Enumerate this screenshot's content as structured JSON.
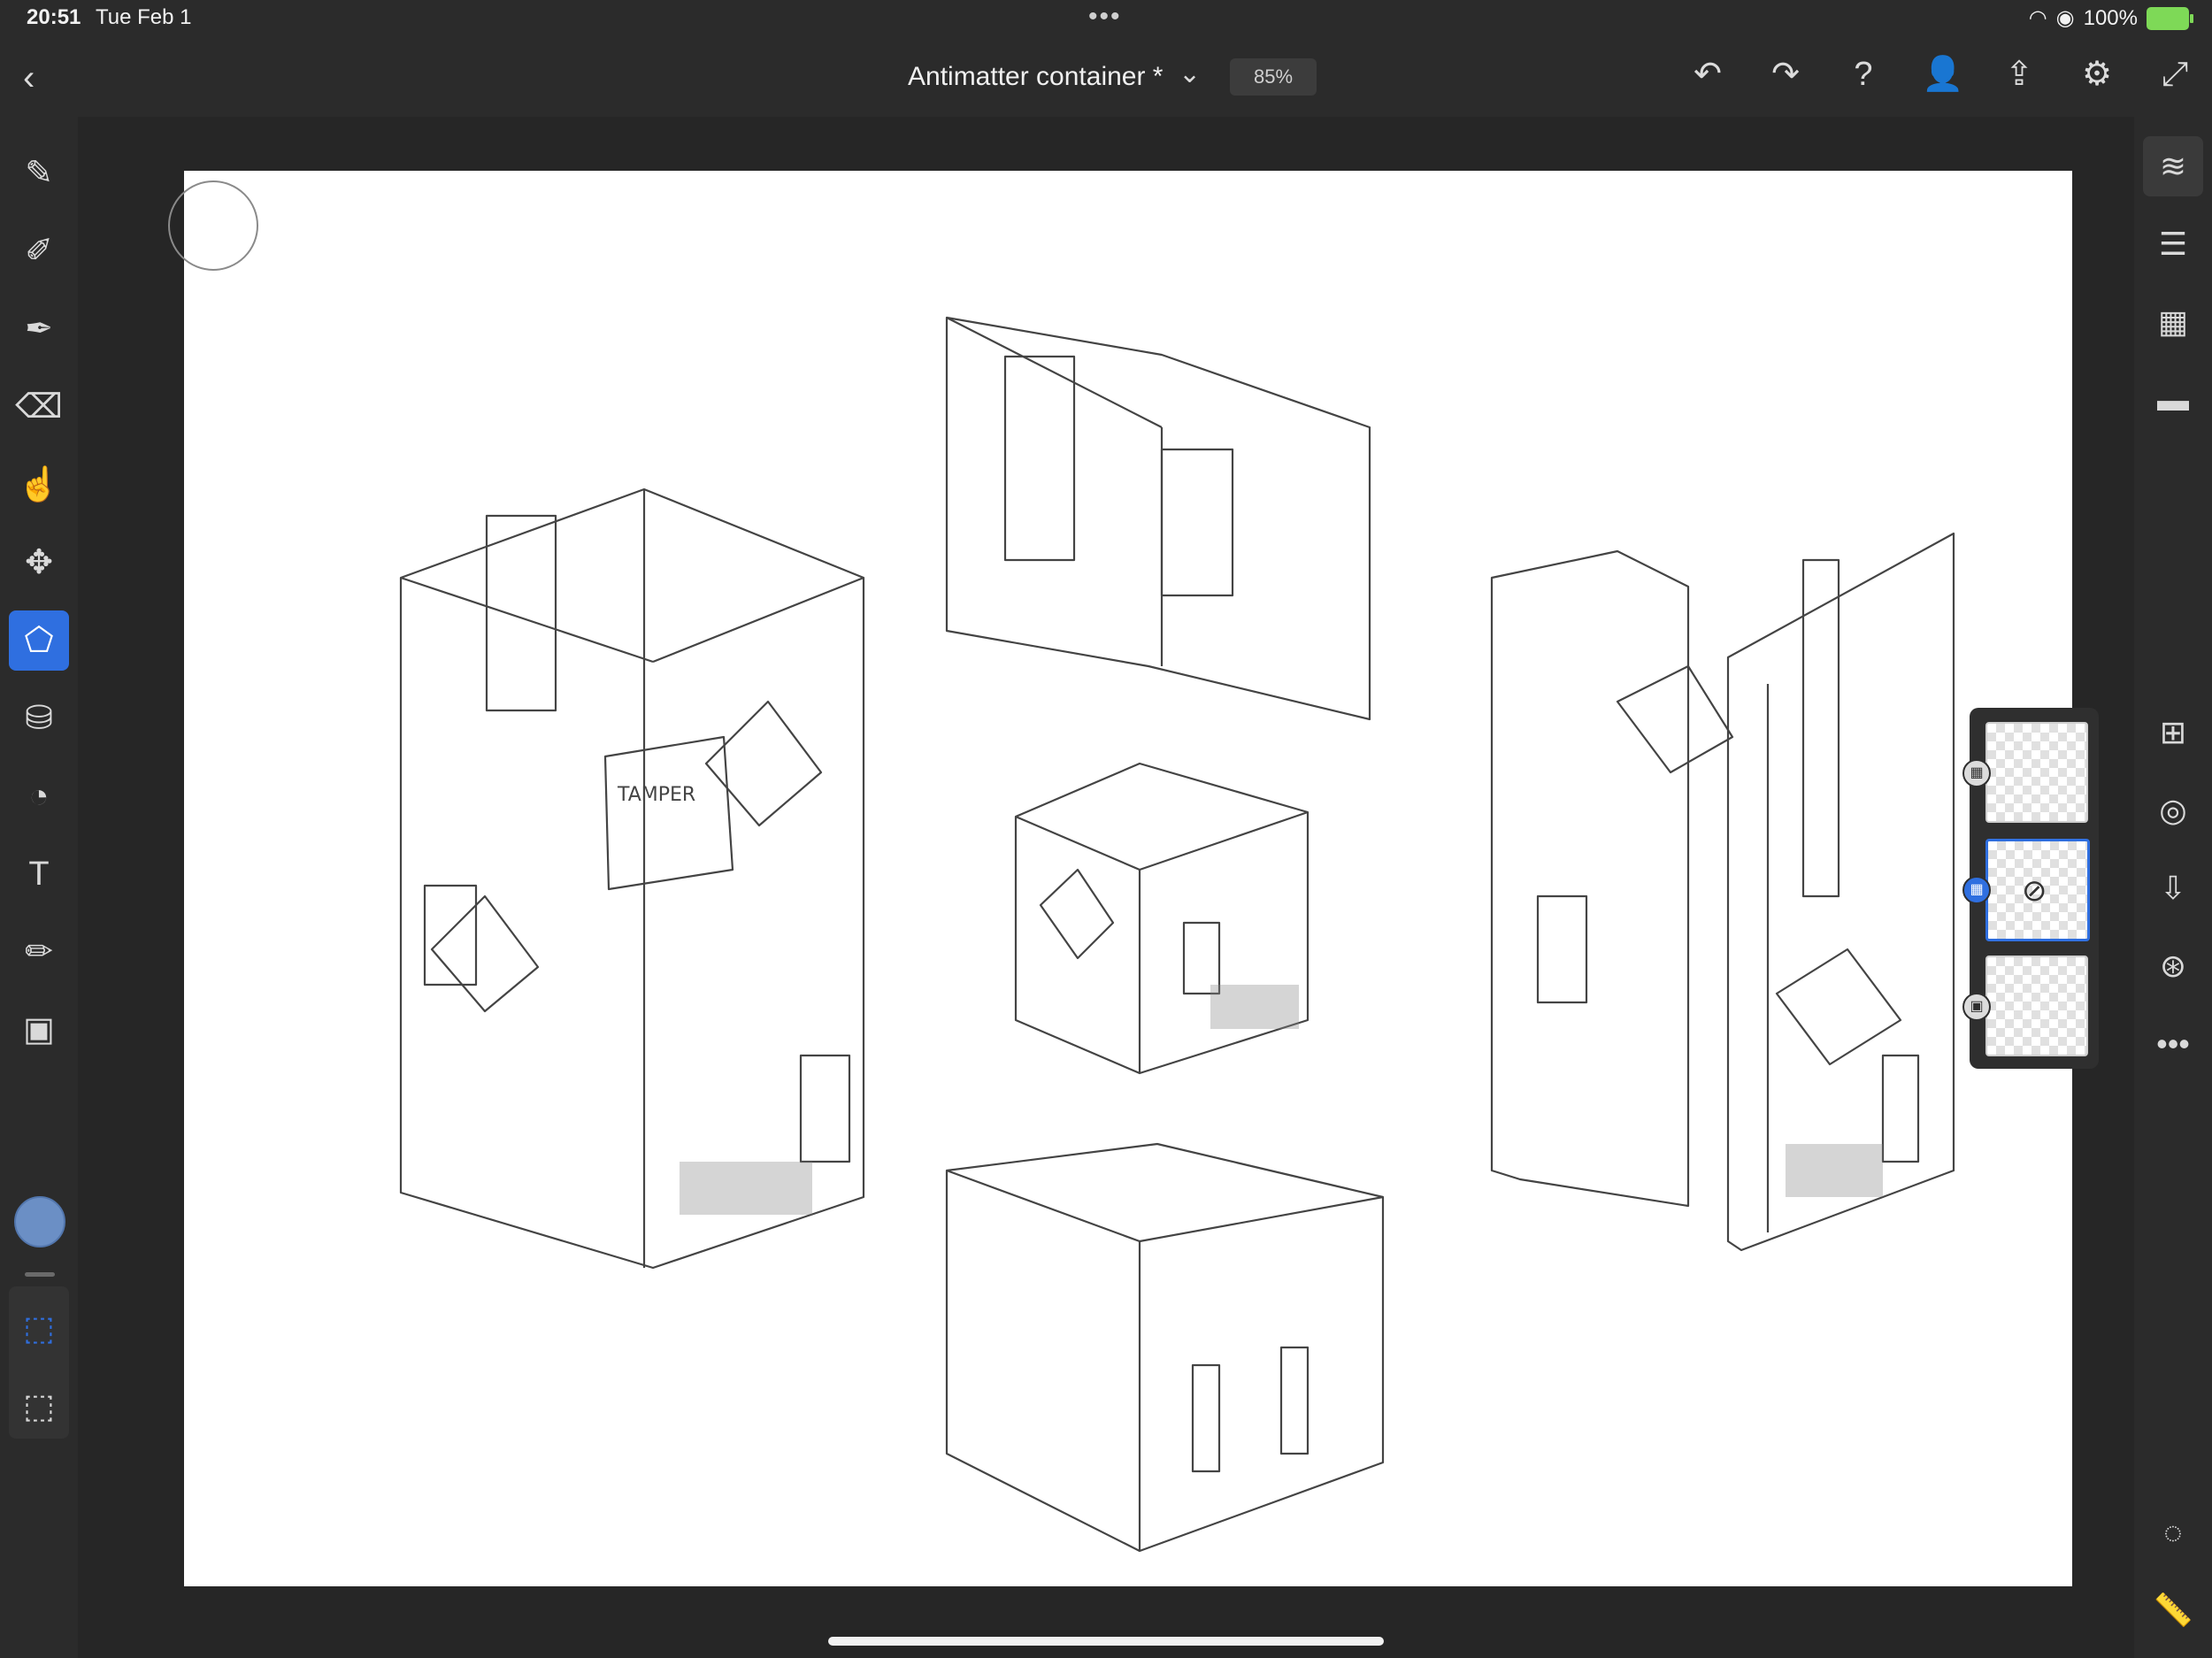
{
  "status_bar": {
    "time": "20:51",
    "date": "Tue Feb 1",
    "battery": "100%",
    "more_dots": "•••"
  },
  "header": {
    "back_icon": "‹",
    "document_title": "Antimatter container *",
    "title_chevron": "⌄",
    "zoom": "85%"
  },
  "top_actions": [
    {
      "name": "undo-icon",
      "glyph": "↶"
    },
    {
      "name": "redo-icon",
      "glyph": "↷"
    },
    {
      "name": "help-icon",
      "glyph": "?"
    },
    {
      "name": "invite-icon",
      "glyph": "👤"
    },
    {
      "name": "share-icon",
      "glyph": "⇪"
    },
    {
      "name": "settings-icon",
      "glyph": "⚙"
    },
    {
      "name": "fullscreen-icon",
      "glyph": "⤢"
    }
  ],
  "left_tools": [
    {
      "name": "pixel-brush-icon",
      "glyph": "✎"
    },
    {
      "name": "live-brush-icon",
      "glyph": "✐"
    },
    {
      "name": "vector-brush-icon",
      "glyph": "✒"
    },
    {
      "name": "eraser-icon",
      "glyph": "⌫"
    },
    {
      "name": "smudge-icon",
      "glyph": "☝"
    },
    {
      "name": "move-icon",
      "glyph": "✥"
    },
    {
      "name": "lasso-select-icon",
      "glyph": "⬠"
    },
    {
      "name": "fill-icon",
      "glyph": "⛁"
    },
    {
      "name": "shape-icon",
      "glyph": "◔"
    },
    {
      "name": "text-icon",
      "glyph": "T"
    },
    {
      "name": "eyedropper-icon",
      "glyph": "✏"
    },
    {
      "name": "image-icon",
      "glyph": "▣"
    }
  ],
  "left_bottom_tools": [
    {
      "name": "selection-add-icon",
      "glyph": "⬚"
    },
    {
      "name": "selection-subtract-icon",
      "glyph": "⬚"
    }
  ],
  "colors": {
    "active_color": "#6b8fc5",
    "accent": "#2f6fe0"
  },
  "right_tools": [
    {
      "name": "layers-icon",
      "glyph": "≋"
    },
    {
      "name": "adjustments-icon",
      "glyph": "☰"
    },
    {
      "name": "grid-icon",
      "glyph": "▦"
    },
    {
      "name": "comments-icon",
      "glyph": "▬"
    }
  ],
  "right_layer_tools": [
    {
      "name": "add-layer-icon",
      "glyph": "⊞"
    },
    {
      "name": "hide-layer-icon",
      "glyph": "◎"
    },
    {
      "name": "merge-down-icon",
      "glyph": "⇩"
    },
    {
      "name": "blend-mode-icon",
      "glyph": "⊛"
    },
    {
      "name": "more-options-icon",
      "glyph": "•••"
    }
  ],
  "right_bottom_tools": [
    {
      "name": "touch-shortcut-icon",
      "glyph": "◌"
    },
    {
      "name": "ruler-icon",
      "glyph": "📏"
    }
  ],
  "layers": [
    {
      "name": "layer-1",
      "badge": "▦",
      "selected": false
    },
    {
      "name": "layer-2-hidden",
      "badge": "▦",
      "selected": true
    },
    {
      "name": "layer-background",
      "badge": "▣",
      "selected": false
    }
  ]
}
